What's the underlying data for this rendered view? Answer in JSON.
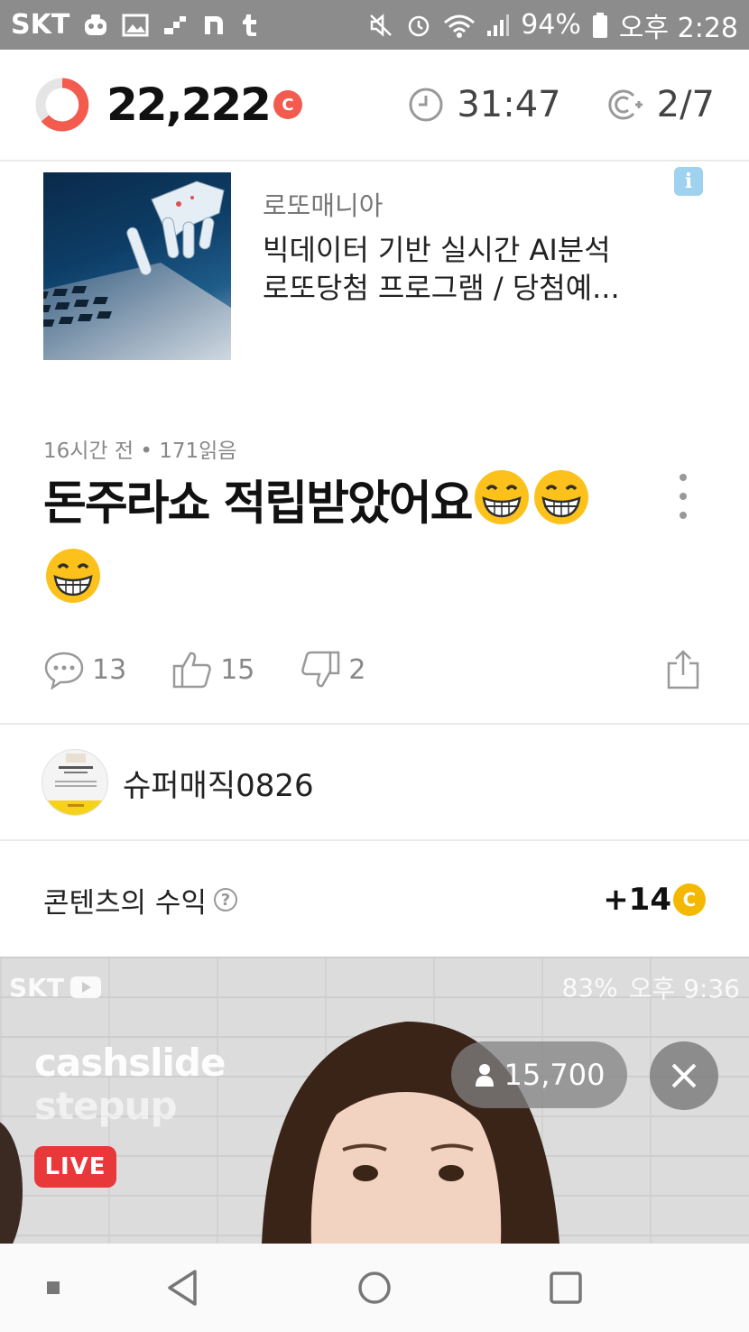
{
  "status_bar": {
    "carrier": "SKT",
    "battery": "94%",
    "time": "오후 2:28"
  },
  "top_bar": {
    "points": "22,222",
    "coin_symbol": "C",
    "timer": "31:47",
    "progress_count": "2/7",
    "accent_color": "#f25b4d"
  },
  "ad": {
    "source": "로또매니아",
    "title_line1": "빅데이터 기반 실시간 AI분석",
    "title_line2": "로또당첨 프로그램 / 당첨예...",
    "info_icon": "i"
  },
  "post": {
    "meta": "16시간 전 • 171읽음",
    "title": "돈주라쇼 적립받았어요",
    "comments": "13",
    "likes": "15",
    "dislikes": "2"
  },
  "author": {
    "name": "슈퍼매직0826"
  },
  "earnings": {
    "label": "콘텐츠의 수익",
    "help": "?",
    "value": "+14",
    "coin_symbol": "C",
    "coin_color": "#f5b800"
  },
  "video": {
    "carrier": "SKT",
    "battery": "83%",
    "time": "오후 9:36",
    "brand_line1": "cashslide",
    "brand_line2": "stepup",
    "live_label": "LIVE",
    "viewers": "15,700"
  }
}
